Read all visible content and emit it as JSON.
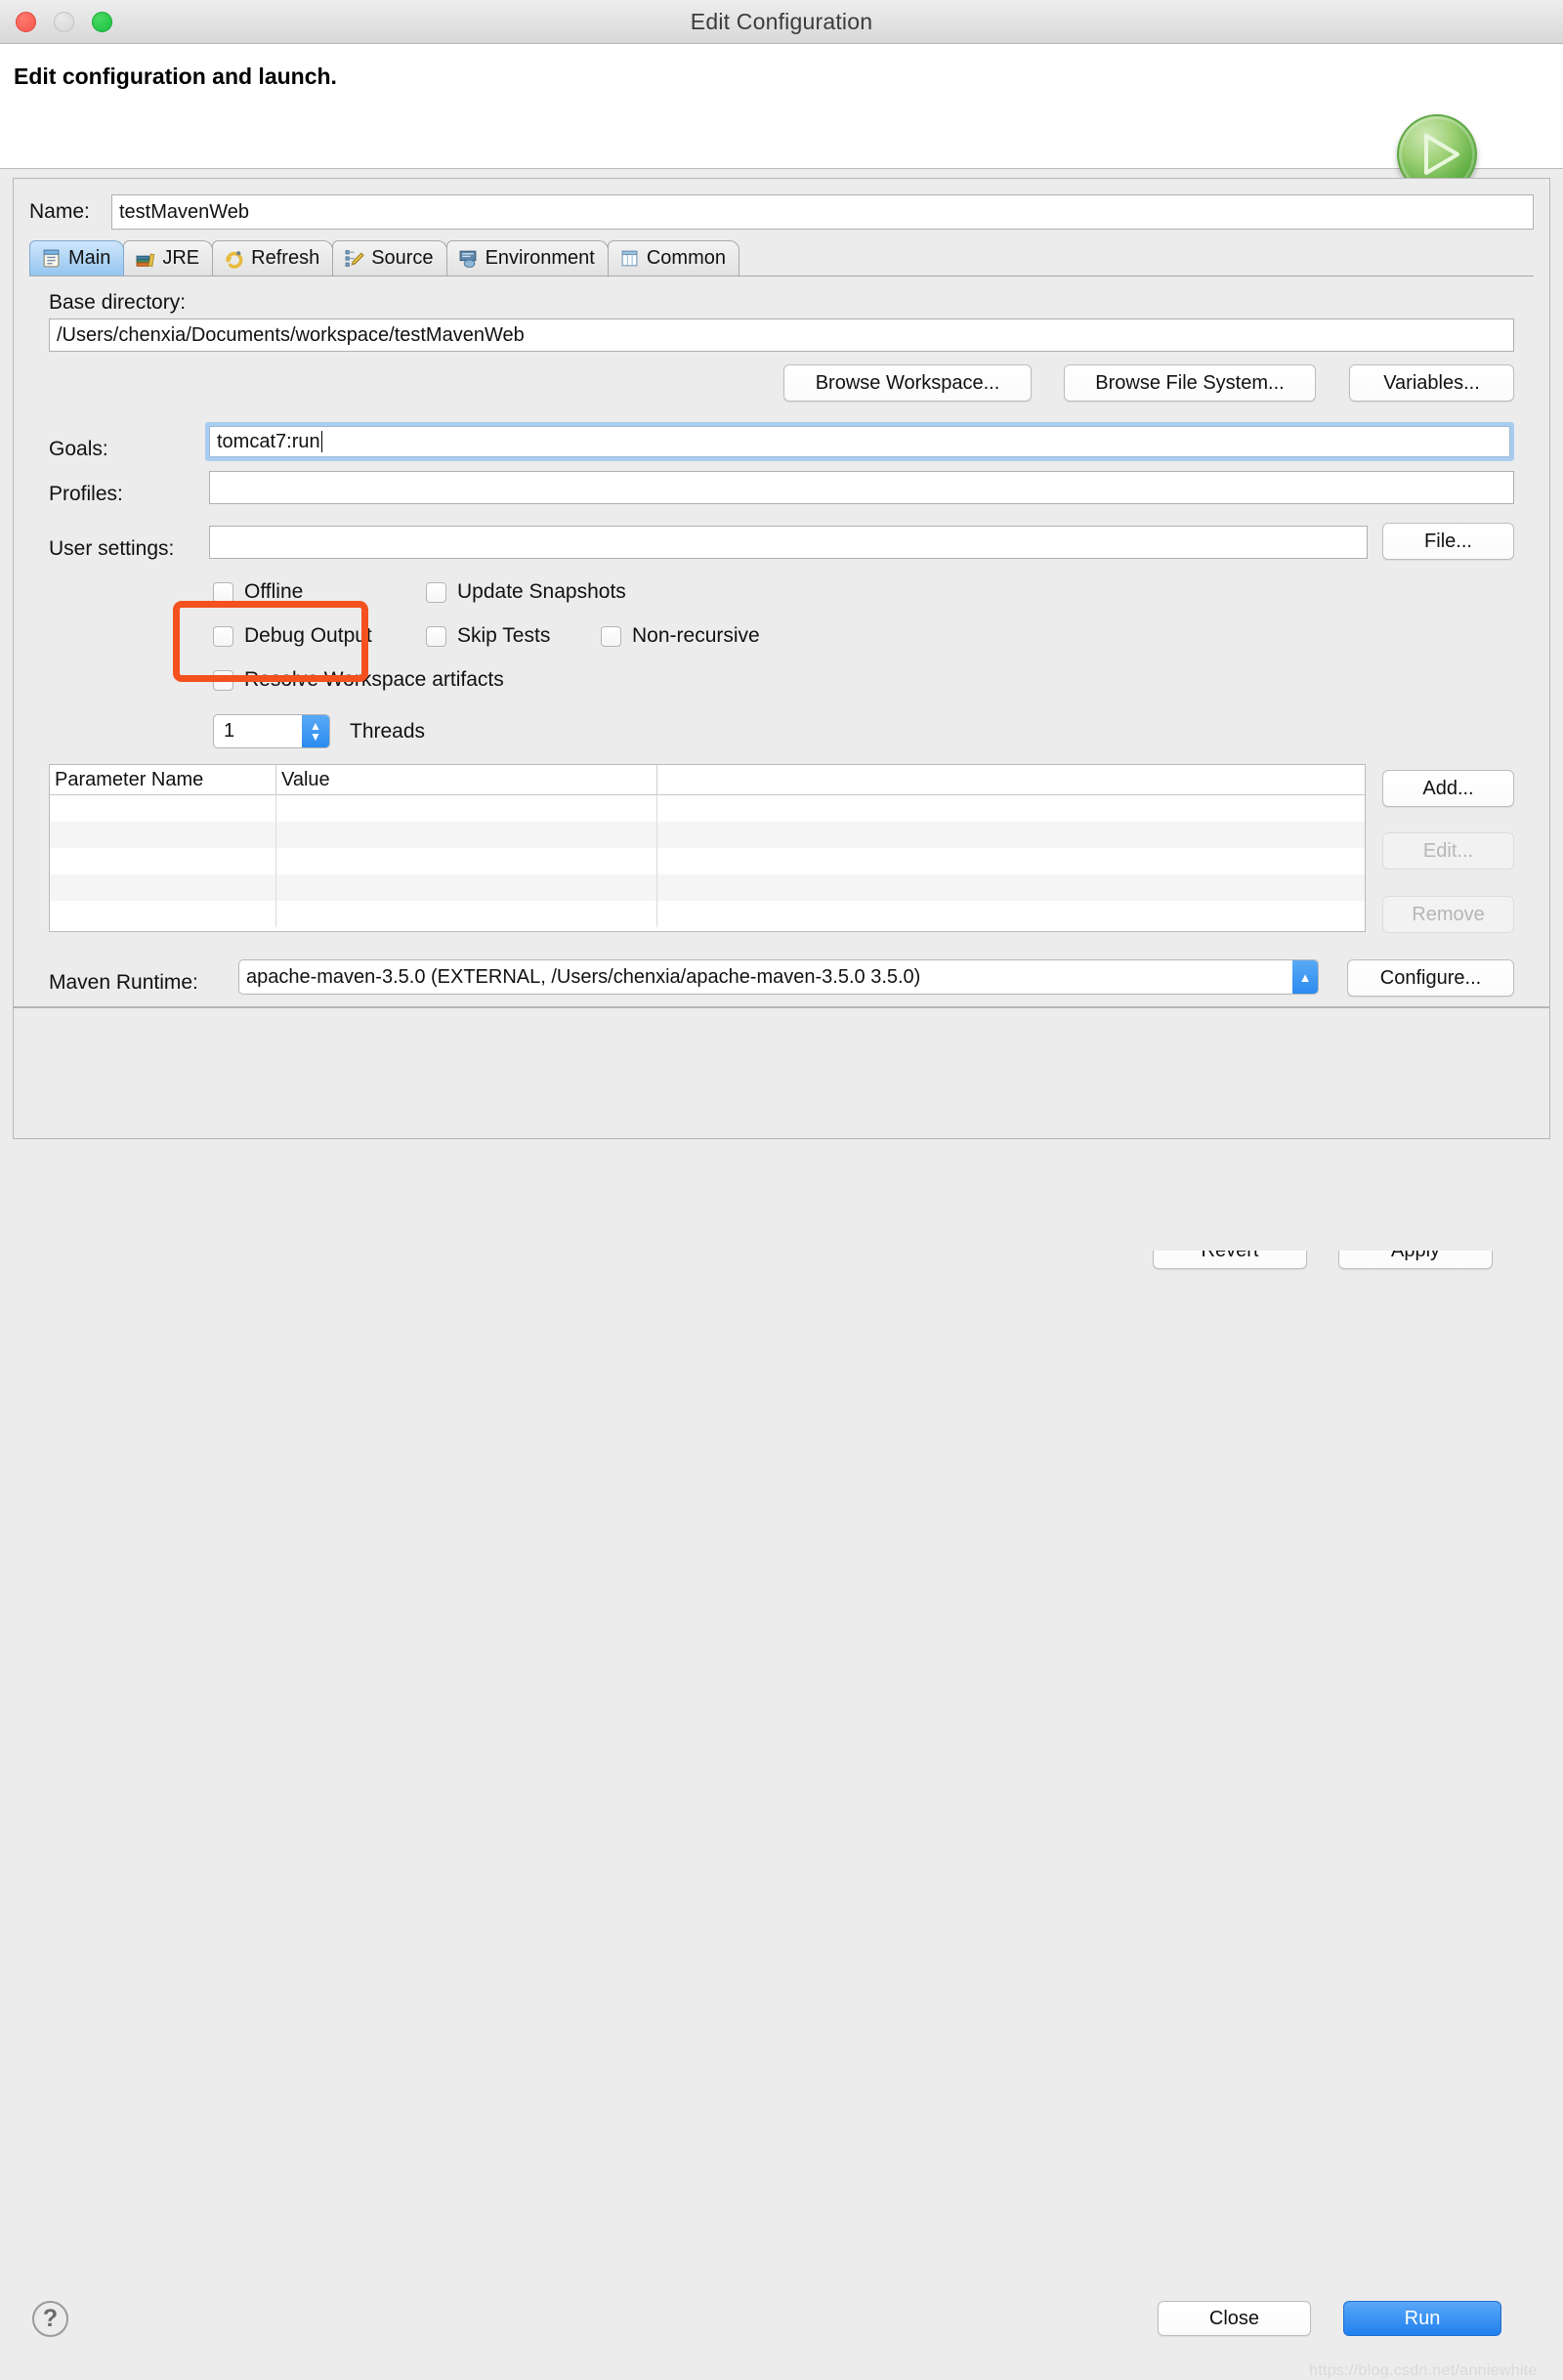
{
  "window": {
    "title": "Edit Configuration",
    "traffic_lights": [
      "close",
      "minimize",
      "zoom"
    ]
  },
  "header": {
    "heading": "Edit configuration and launch.",
    "badge_icon": "run-play-icon"
  },
  "form": {
    "name_label": "Name:",
    "name_value": "testMavenWeb"
  },
  "tabs": [
    {
      "label": "Main",
      "icon": "document-icon",
      "active": true
    },
    {
      "label": "JRE",
      "icon": "books-icon",
      "active": false
    },
    {
      "label": "Refresh",
      "icon": "refresh-icon",
      "active": false
    },
    {
      "label": "Source",
      "icon": "source-edit-icon",
      "active": false
    },
    {
      "label": "Environment",
      "icon": "environment-icon",
      "active": false
    },
    {
      "label": "Common",
      "icon": "table-icon",
      "active": false
    }
  ],
  "main_tab": {
    "base_directory_label": "Base directory:",
    "base_directory_value": "/Users/chenxia/Documents/workspace/testMavenWeb",
    "browse_workspace_label": "Browse Workspace...",
    "browse_filesystem_label": "Browse File System...",
    "variables_label": "Variables...",
    "goals_label": "Goals:",
    "goals_value": "tomcat7:run",
    "profiles_label": "Profiles:",
    "profiles_value": "",
    "user_settings_label": "User settings:",
    "user_settings_value": "",
    "file_label": "File...",
    "checkboxes": [
      {
        "label": "Offline",
        "checked": false
      },
      {
        "label": "Update Snapshots",
        "checked": false
      },
      {
        "label": "Debug Output",
        "checked": false
      },
      {
        "label": "Skip Tests",
        "checked": false
      },
      {
        "label": "Non-recursive",
        "checked": false
      },
      {
        "label": "Resolve Workspace artifacts",
        "checked": false
      }
    ],
    "threads_value": "1",
    "threads_label": "Threads",
    "table": {
      "columns": [
        "Parameter Name",
        "Value",
        ""
      ],
      "rows": []
    },
    "add_label": "Add...",
    "edit_label": "Edit...",
    "remove_label": "Remove",
    "maven_runtime_label": "Maven Runtime:",
    "maven_runtime_value": "apache-maven-3.5.0 (EXTERNAL, /Users/chenxia/apache-maven-3.5.0 3.5.0)",
    "configure_label": "Configure..."
  },
  "panel_buttons": {
    "revert_label": "Revert",
    "apply_label": "Apply"
  },
  "footer": {
    "help_glyph": "?",
    "close_label": "Close",
    "run_label": "Run",
    "watermark": "https://blog.csdn.net/anniewhite"
  },
  "colors": {
    "accent_blue": "#2180ef",
    "highlight_red": "#f4511e",
    "focus_blue": "#a8cdf0",
    "window_bg": "#ececec"
  }
}
